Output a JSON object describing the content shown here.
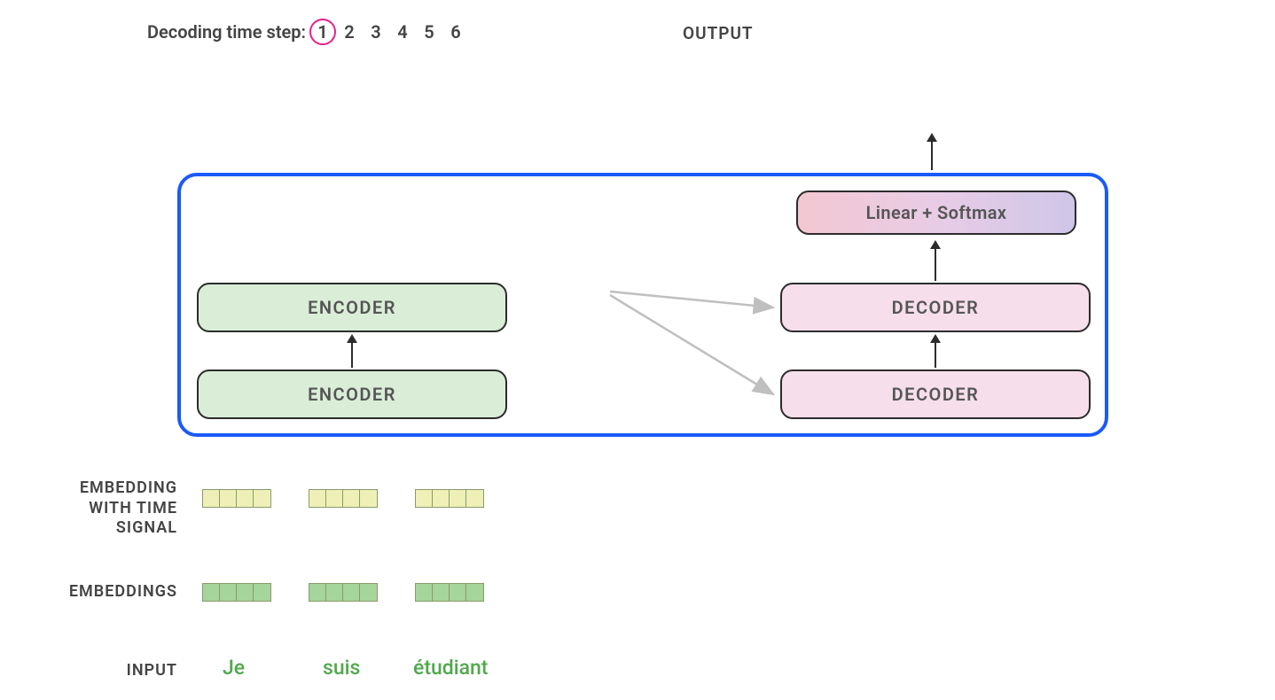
{
  "timestep": {
    "label": "Decoding time step:",
    "steps": [
      "1",
      "2",
      "3",
      "4",
      "5",
      "6"
    ],
    "active_index": 0
  },
  "output_label": "OUTPUT",
  "blocks": {
    "encoder_top": "ENCODER",
    "encoder_bottom": "ENCODER",
    "decoder_top": "DECODER",
    "decoder_bottom": "DECODER",
    "softmax": "Linear + Softmax"
  },
  "row_labels": {
    "embedding_time": "EMBEDDING\nWITH TIME\nSIGNAL",
    "embeddings": "EMBEDDINGS",
    "input": "INPUT"
  },
  "input_words": [
    "Je",
    "suis",
    "étudiant"
  ],
  "vector_cells": 4
}
